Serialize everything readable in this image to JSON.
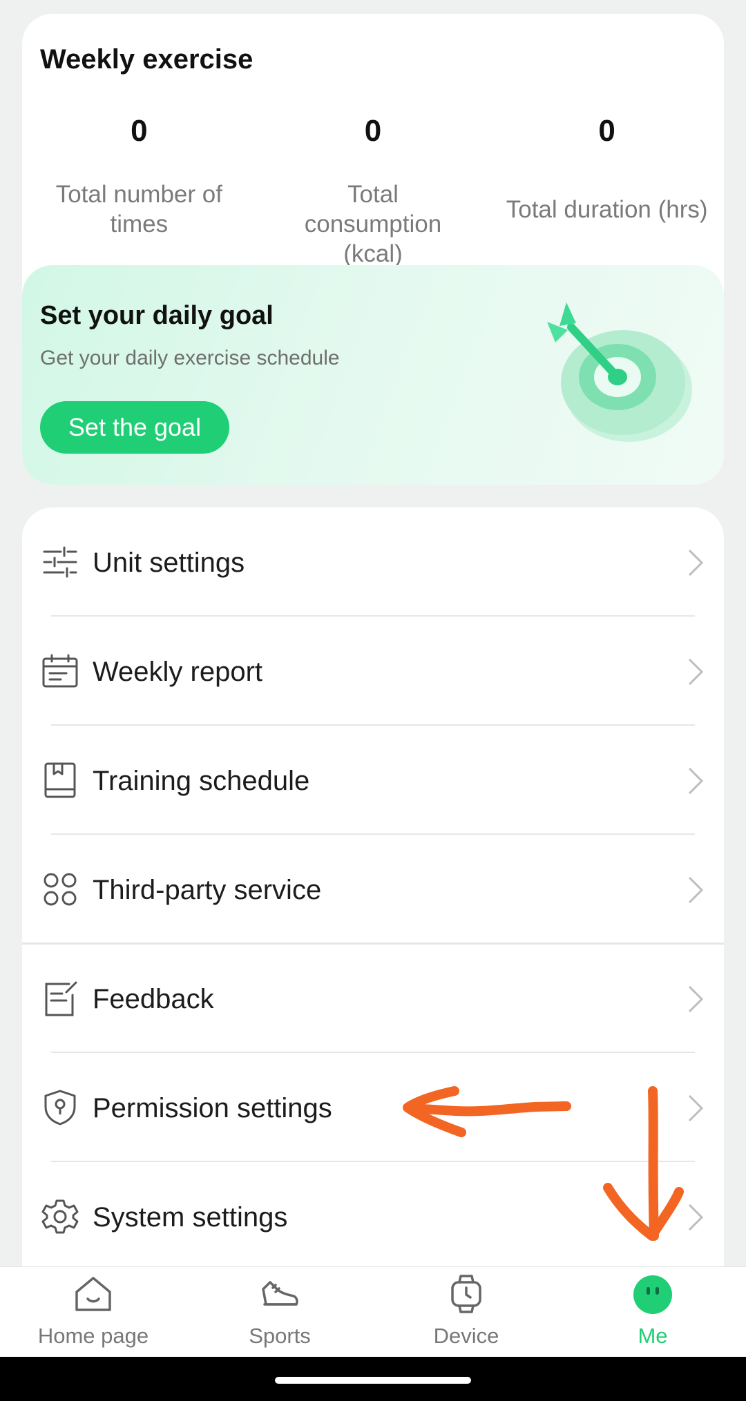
{
  "weekly": {
    "title": "Weekly exercise",
    "stats": [
      {
        "value": "0",
        "label": "Total number of times"
      },
      {
        "value": "0",
        "label": "Total consumption (kcal)"
      },
      {
        "value": "0",
        "label": "Total duration (hrs)"
      }
    ]
  },
  "goal": {
    "title": "Set your daily goal",
    "subtitle": "Get your daily exercise schedule",
    "button": "Set the goal",
    "icon": "target-arrow-icon"
  },
  "menu": {
    "items": [
      {
        "label": "Unit settings",
        "icon": "sliders-icon"
      },
      {
        "label": "Weekly report",
        "icon": "calendar-report-icon"
      },
      {
        "label": "Training schedule",
        "icon": "book-icon"
      },
      {
        "label": "Third-party service",
        "icon": "apps-grid-icon"
      },
      {
        "label": "Feedback",
        "icon": "feedback-edit-icon"
      },
      {
        "label": "Permission settings",
        "icon": "shield-lock-icon"
      },
      {
        "label": "System settings",
        "icon": "gear-icon"
      }
    ]
  },
  "nav": {
    "items": [
      {
        "label": "Home page",
        "icon": "home-smile-icon",
        "active": false
      },
      {
        "label": "Sports",
        "icon": "sneaker-icon",
        "active": false
      },
      {
        "label": "Device",
        "icon": "watch-icon",
        "active": false
      },
      {
        "label": "Me",
        "icon": "profile-face-icon",
        "active": true
      }
    ]
  },
  "colors": {
    "accent": "#1fce75",
    "annotation": "#f26522",
    "background": "#eef1f0"
  }
}
